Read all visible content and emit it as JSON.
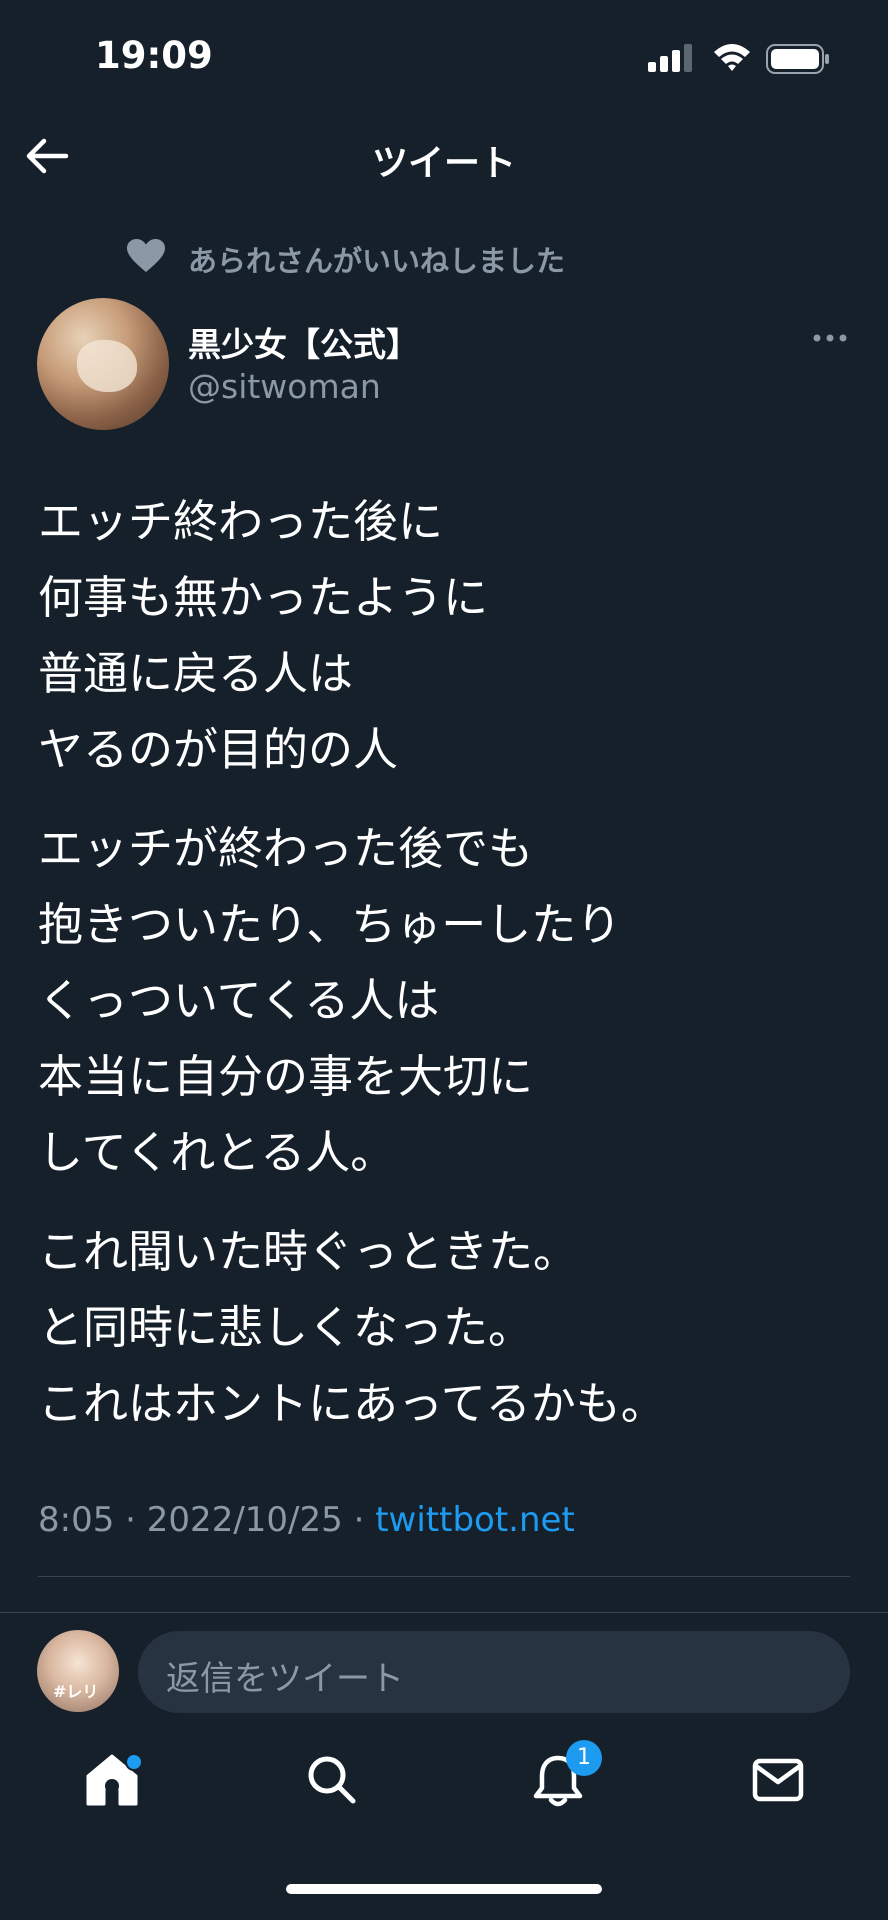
{
  "status_bar": {
    "time": "19:09"
  },
  "header": {
    "title": "ツイート"
  },
  "social_context": {
    "text": "あられさんがいいねしました"
  },
  "author": {
    "display_name": "黒少女【公式】",
    "handle": "@sitwoman"
  },
  "tweet": {
    "paragraphs": [
      [
        "エッチ終わった後に",
        "何事も無かったように",
        "普通に戻る人は",
        "ヤるのが目的の人"
      ],
      [
        "エッチが終わった後でも",
        "抱きついたり、ちゅーしたり",
        "くっついてくる人は",
        "本当に自分の事を大切に",
        "してくれとる人。"
      ],
      [
        "これ聞いた時ぐっときた。",
        "と同時に悲しくなった。",
        "これはホントにあってるかも。"
      ]
    ],
    "time": "8:05",
    "date": "2022/10/25",
    "separator": "·",
    "source": "twittbot.net"
  },
  "reply": {
    "placeholder": "返信をツイート",
    "avatar_label": "#レリ"
  },
  "tabbar": {
    "notifications_badge": "1",
    "icons": [
      "home-icon",
      "search-icon",
      "bell-icon",
      "mail-icon"
    ]
  },
  "colors": {
    "background": "#15202b",
    "accent": "#1d9bf0",
    "secondary_text": "#8b98a5",
    "divider": "#38444d"
  }
}
